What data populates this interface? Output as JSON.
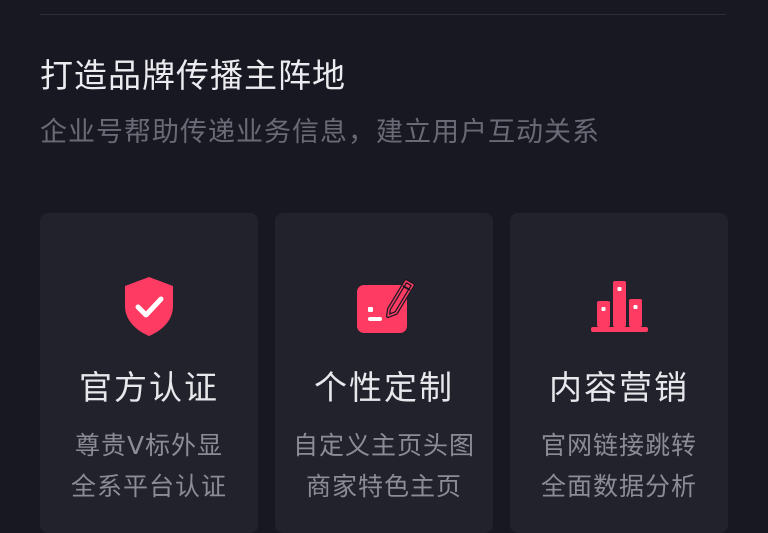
{
  "section": {
    "title": "打造品牌传播主阵地",
    "subtitle": "企业号帮助传递业务信息，建立用户互动关系"
  },
  "accent_color": "#fe3c63",
  "cards": [
    {
      "icon": "shield-check-icon",
      "title": "官方认证",
      "lines": [
        "尊贵V标外显",
        "全系平台认证"
      ]
    },
    {
      "icon": "edit-note-icon",
      "title": "个性定制",
      "lines": [
        "自定义主页头图",
        "商家特色主页"
      ]
    },
    {
      "icon": "bar-chart-icon",
      "title": "内容营销",
      "lines": [
        "官网链接跳转",
        "全面数据分析"
      ]
    }
  ]
}
